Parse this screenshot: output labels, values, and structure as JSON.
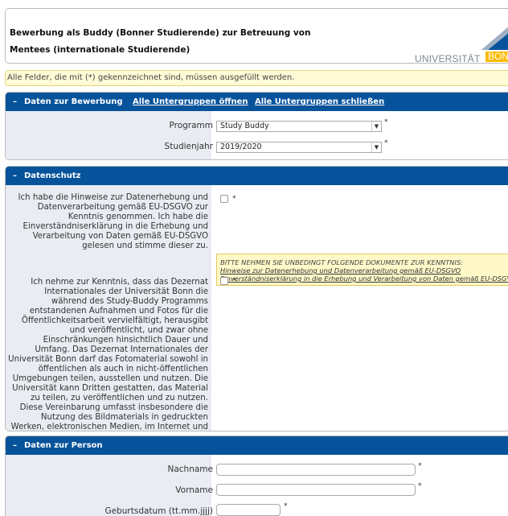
{
  "header": {
    "title": "Bewerbung als Buddy (Bonner Studierende) zur Betreuung von Mentees (internationale Studierende)",
    "logo": {
      "university": "UNIVERSITÄT",
      "city": "BONN",
      "accent": "#fbb900",
      "brand": "#07539b"
    }
  },
  "notice": "Alle Felder, die mit (*) gekennzeichnet sind, müssen ausgefüllt werden.",
  "sections": {
    "bewerbung": {
      "toggle": "–",
      "title": "Daten zur Bewerbung",
      "open_all": "Alle Untergruppen öffnen",
      "close_all": "Alle Untergruppen schließen",
      "programm_label": "Programm",
      "programm_value": "Study Buddy",
      "studienjahr_label": "Studienjahr",
      "studienjahr_value": "2019/2020",
      "required": "*"
    },
    "datenschutz": {
      "toggle": "–",
      "title": "Datenschutz",
      "consent1": "Ich habe die Hinweise zur Datenerhebung und Datenverarbeitung gemäß EU-DSGVO zur Kenntnis genommen. Ich habe die Einverständniserklärung in die Erhebung und Verarbeitung von Daten gemäß EU-DSGVO gelesen und stimme dieser zu.",
      "docs_heading": "BITTE NEHMEN SIE UNBEDINGT FOLGENDE DOKUMENTE ZUR KENNTNIS:",
      "doc_link1": "Hinweise zur Datenerhebung und Datenverarbeitung gemäß EU-DSGVO",
      "doc_link2": "Einverständniserklärung in die Erhebung und Verarbeitung von Daten gemäß EU-DSGVO",
      "consent2": "Ich nehme zur Kenntnis, dass das Dezernat Internationales der Universität Bonn die während des Study-Buddy Programms entstandenen Aufnahmen und Fotos für die Öffentlichkeitsarbeit vervielfältigt, herausgibt und veröffentlicht, und zwar ohne Einschränkungen hinsichtlich Dauer und Umfang. Das Dezernat Internationales der Universität Bonn darf das Fotomaterial sowohl in öffentlichen als auch in nicht-öffentlichen Umgebungen teilen, ausstellen und nutzen. Die Universität kann Dritten gestatten, das Material zu teilen, zu veröffentlichen und zu nutzen. Diese Vereinbarung umfasst insbesondere die Nutzung des Bildmaterials in gedruckten Werken, elektronischen Medien, im Internet und in sozialen Netzwerken (z.B. Facebook, Twitter und Instagram).",
      "required": "*"
    },
    "person": {
      "toggle": "–",
      "title": "Daten zur Person",
      "nachname_label": "Nachname",
      "nachname_value": "",
      "vorname_label": "Vorname",
      "vorname_value": "",
      "geburtsdatum_label": "Geburtsdatum (tt.mm.jjjj)",
      "geburtsdatum_value": "",
      "required": "*"
    }
  }
}
